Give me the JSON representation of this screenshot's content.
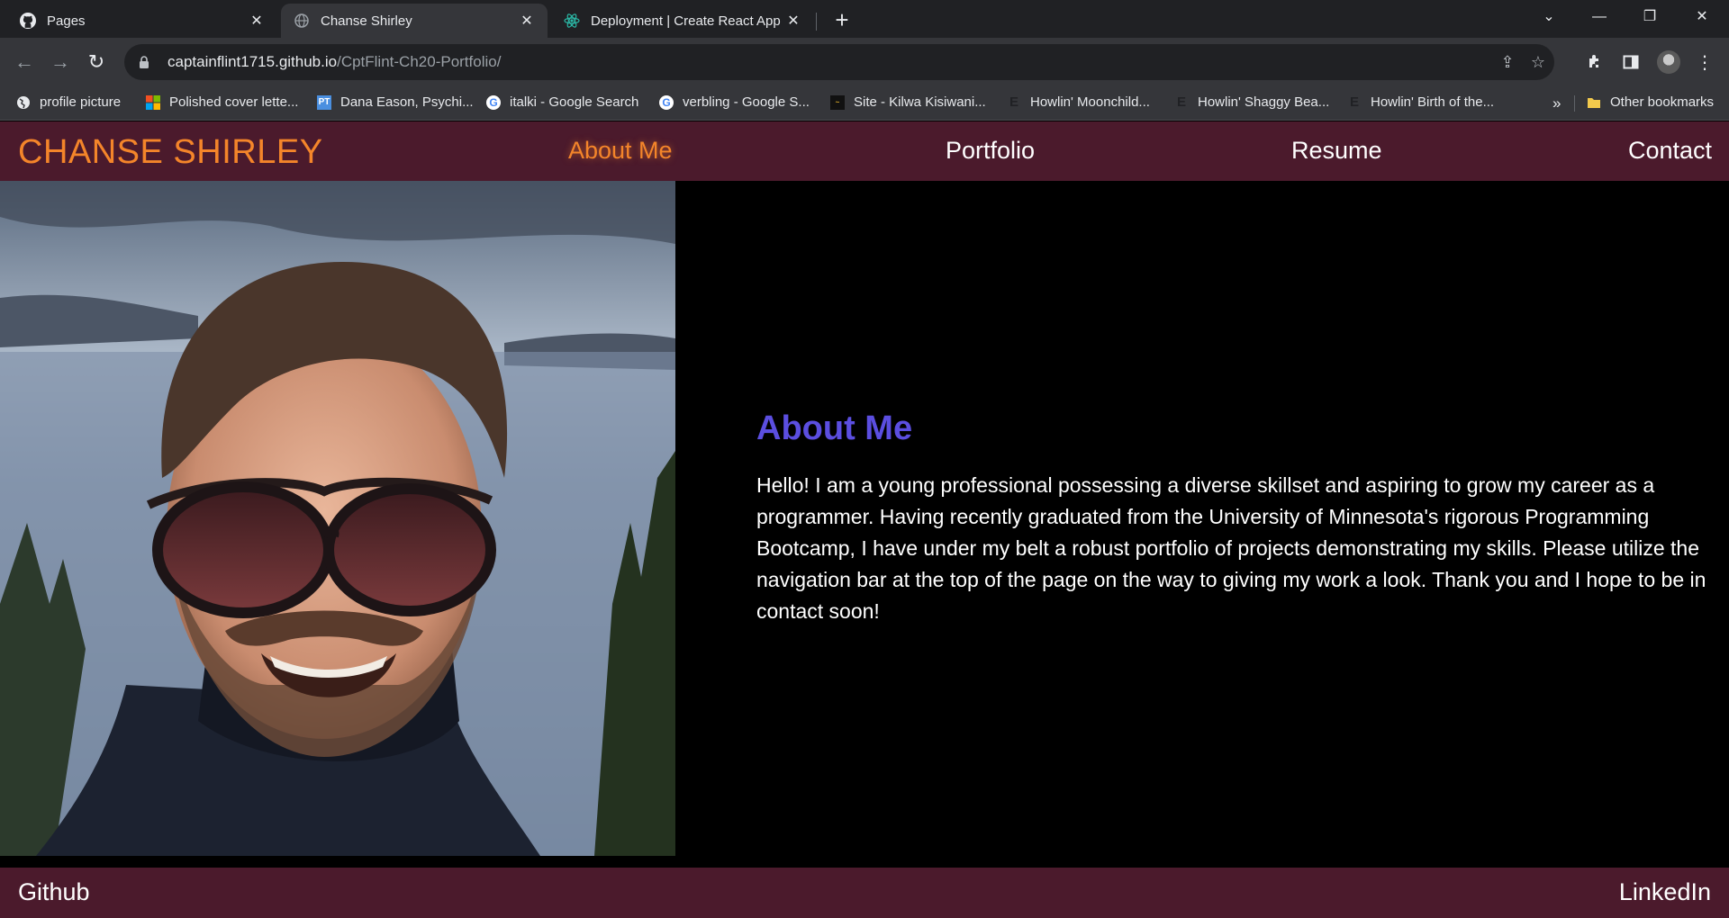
{
  "browser": {
    "tabs": [
      {
        "title": "Pages",
        "icon": "github-icon",
        "active": false
      },
      {
        "title": "Chanse Shirley",
        "icon": "globe-icon",
        "active": true
      },
      {
        "title": "Deployment | Create React App",
        "icon": "react-icon",
        "active": false
      }
    ],
    "url_host": "captainflint1715.github.io",
    "url_path": "/CptFlint-Ch20-Portfolio/",
    "bookmarks": [
      {
        "label": "profile picture",
        "icon": "globe-icon"
      },
      {
        "label": "Polished cover lette...",
        "icon": "microsoft-icon"
      },
      {
        "label": "Dana Eason, Psychi...",
        "icon": "pt-icon"
      },
      {
        "label": "italki - Google Search",
        "icon": "google-icon"
      },
      {
        "label": "verbling - Google S...",
        "icon": "google-icon"
      },
      {
        "label": "Site - Kilwa Kisiwani...",
        "icon": "site-icon"
      },
      {
        "label": "Howlin' Moonchild...",
        "icon": "e-icon"
      },
      {
        "label": "Howlin' Shaggy Bea...",
        "icon": "e-icon"
      },
      {
        "label": "Howlin' Birth of the...",
        "icon": "e-icon"
      }
    ],
    "overflow_label": "»",
    "other_bookmarks": "Other bookmarks"
  },
  "site": {
    "name": "CHANSE SHIRLEY",
    "nav": [
      "About Me",
      "Portfolio",
      "Resume",
      "Contact"
    ],
    "active_nav": "About Me",
    "about": {
      "heading": "About Me",
      "body": "Hello! I am a young professional possessing a diverse skillset and aspiring to grow my career as a programmer. Having recently graduated from the University of Minnesota's rigorous Programming Bootcamp, I have under my belt a robust portfolio of projects demonstrating my skills. Please utilize the navigation bar at the top of the page on the way to giving my work a look. Thank you and I hope to be in contact soon!"
    },
    "footer": {
      "left": "Github",
      "right": "LinkedIn"
    }
  },
  "colors": {
    "header_bg": "#4b1a2c",
    "accent_orange": "#f4852a",
    "heading_purple": "#5b4ee0",
    "page_bg": "#000000"
  }
}
